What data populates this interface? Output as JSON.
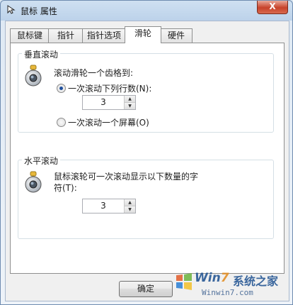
{
  "window": {
    "title": "鼠标 属性",
    "close_glyph": "X"
  },
  "tabs": [
    {
      "label": "鼠标键"
    },
    {
      "label": "指针"
    },
    {
      "label": "指针选项"
    },
    {
      "label": "滑轮",
      "active": true
    },
    {
      "label": "硬件"
    }
  ],
  "vertical": {
    "title": "垂直滚动",
    "prompt": "滚动滑轮一个齿格到:",
    "option_lines_label": "一次滚动下列行数(N):",
    "lines_value": "3",
    "option_screen_label": "一次滚动一个屏幕(O)",
    "selected": "lines"
  },
  "horizontal": {
    "title": "水平滚动",
    "prompt_line1": "鼠标滚轮可一次滚动显示以下数量的字",
    "prompt_line2": "符(T):",
    "chars_value": "3"
  },
  "buttons": {
    "ok": "确定"
  },
  "icons": {
    "title": "mouse-pointer-icon",
    "wheel": "mouse-wheel-icon",
    "close": "close-icon"
  },
  "watermark": {
    "brand_a": "Win",
    "brand_b": "7",
    "cn": "系统之家",
    "url": "Winwin7.com"
  },
  "colors": {
    "radio_dot": "#1f4f9c",
    "close_button": "#c7422a"
  }
}
